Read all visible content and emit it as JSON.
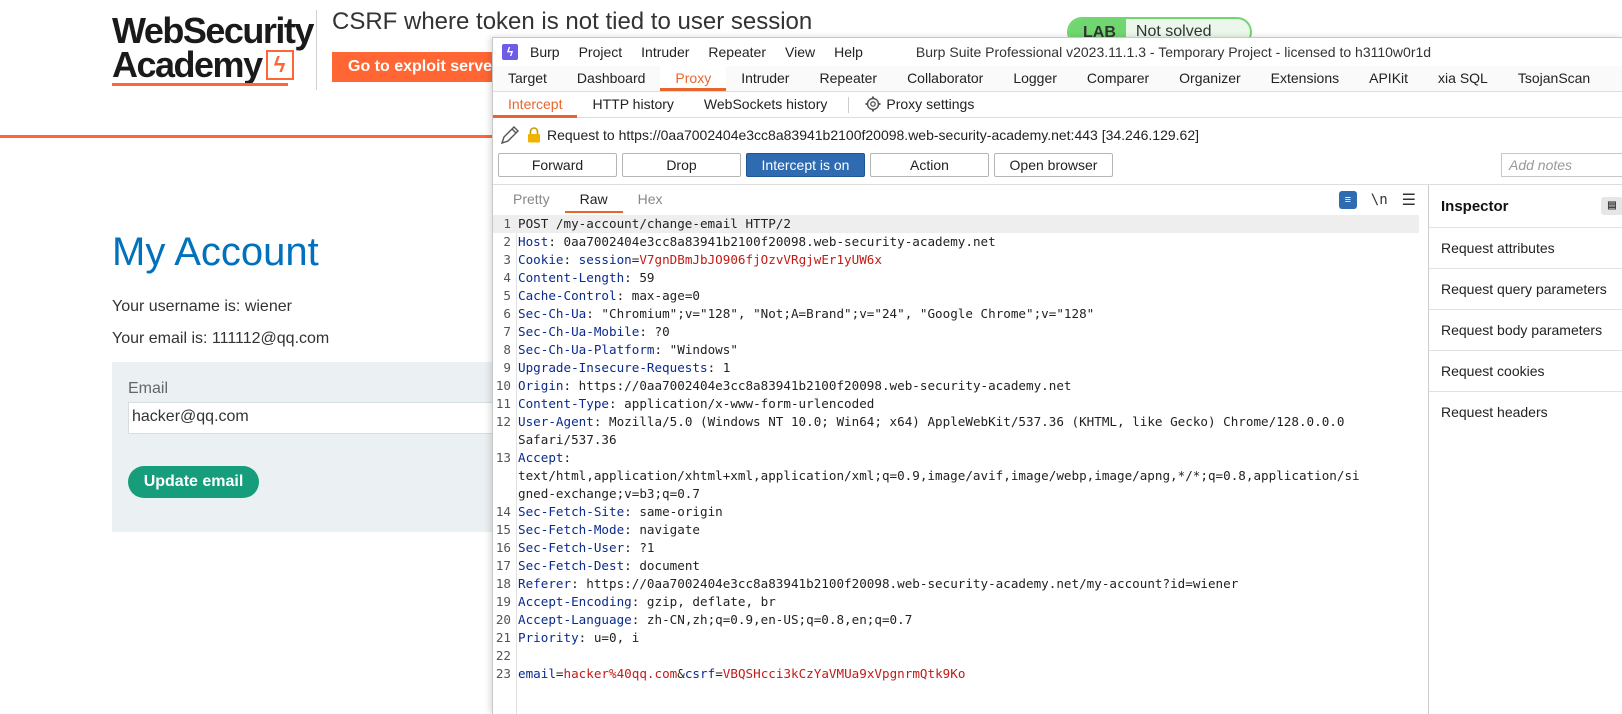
{
  "site": {
    "logo_line1": "WebSecurity",
    "logo_line2": "Academy",
    "lab_title": "CSRF where token is not tied to user session",
    "exploit_button": "Go to exploit server",
    "lab_badge": "LAB",
    "lab_status": "Not solved",
    "page_heading": "My Account",
    "username_line": "Your username is: wiener",
    "email_line": "Your email is: 111112@qq.com",
    "email_label": "Email",
    "email_value": "hacker@qq.com",
    "update_button": "Update email"
  },
  "burp": {
    "menu": [
      "Burp",
      "Project",
      "Intruder",
      "Repeater",
      "View",
      "Help"
    ],
    "window_title": "Burp Suite Professional v2023.11.1.3 - Temporary Project - licensed to h3110w0r1d",
    "main_tabs": [
      "Target",
      "Dashboard",
      "Proxy",
      "Intruder",
      "Repeater",
      "Collaborator",
      "Logger",
      "Comparer",
      "Organizer",
      "Extensions",
      "APIKit",
      "xia SQL",
      "TsojanScan"
    ],
    "active_main_tab": "Proxy",
    "sub_tabs": [
      "Intercept",
      "HTTP history",
      "WebSockets history"
    ],
    "active_sub_tab": "Intercept",
    "proxy_settings": "Proxy settings",
    "request_to": "Request to https://0aa7002404e3cc8a83941b2100f20098.web-security-academy.net:443  [34.246.129.62]",
    "buttons": {
      "forward": "Forward",
      "drop": "Drop",
      "intercept": "Intercept is on",
      "action": "Action",
      "open_browser": "Open browser"
    },
    "notes_placeholder": "Add notes",
    "view_tabs": [
      "Pretty",
      "Raw",
      "Hex"
    ],
    "active_view_tab": "Raw",
    "newline_toggle": "\\n",
    "request_lines": [
      {
        "n": "1",
        "k": "",
        "sep": "",
        "v": "POST /my-account/change-email HTTP/2"
      },
      {
        "n": "2",
        "k": "Host",
        "sep": ": ",
        "v": "0aa7002404e3cc8a83941b2100f20098.web-security-academy.net"
      },
      {
        "n": "3",
        "k": "Cookie",
        "sep": ": ",
        "v": ""
      },
      {
        "n": "4",
        "k": "Content-Length",
        "sep": ": ",
        "v": "59"
      },
      {
        "n": "5",
        "k": "Cache-Control",
        "sep": ": ",
        "v": "max-age=0"
      },
      {
        "n": "6",
        "k": "Sec-Ch-Ua",
        "sep": ": ",
        "v": "\"Chromium\";v=\"128\", \"Not;A=Brand\";v=\"24\", \"Google Chrome\";v=\"128\""
      },
      {
        "n": "7",
        "k": "Sec-Ch-Ua-Mobile",
        "sep": ": ",
        "v": "?0"
      },
      {
        "n": "8",
        "k": "Sec-Ch-Ua-Platform",
        "sep": ": ",
        "v": "\"Windows\""
      },
      {
        "n": "9",
        "k": "Upgrade-Insecure-Requests",
        "sep": ": ",
        "v": "1"
      },
      {
        "n": "10",
        "k": "Origin",
        "sep": ": ",
        "v": "https://0aa7002404e3cc8a83941b2100f20098.web-security-academy.net"
      },
      {
        "n": "11",
        "k": "Content-Type",
        "sep": ": ",
        "v": "application/x-www-form-urlencoded"
      },
      {
        "n": "12",
        "k": "User-Agent",
        "sep": ": ",
        "v": "Mozilla/5.0 (Windows NT 10.0; Win64; x64) AppleWebKit/537.36 (KHTML, like Gecko) Chrome/128.0.0.0",
        "cont": "Safari/537.36"
      },
      {
        "n": "13",
        "k": "Accept",
        "sep": ":",
        "v": "",
        "cont": "text/html,application/xhtml+xml,application/xml;q=0.9,image/avif,image/webp,image/apng,*/*;q=0.8,application/si",
        "cont2": "gned-exchange;v=b3;q=0.7"
      },
      {
        "n": "14",
        "k": "Sec-Fetch-Site",
        "sep": ": ",
        "v": "same-origin"
      },
      {
        "n": "15",
        "k": "Sec-Fetch-Mode",
        "sep": ": ",
        "v": "navigate"
      },
      {
        "n": "16",
        "k": "Sec-Fetch-User",
        "sep": ": ",
        "v": "?1"
      },
      {
        "n": "17",
        "k": "Sec-Fetch-Dest",
        "sep": ": ",
        "v": "document"
      },
      {
        "n": "18",
        "k": "Referer",
        "sep": ": ",
        "v": "https://0aa7002404e3cc8a83941b2100f20098.web-security-academy.net/my-account?id=wiener"
      },
      {
        "n": "19",
        "k": "Accept-Encoding",
        "sep": ": ",
        "v": "gzip, deflate, br"
      },
      {
        "n": "20",
        "k": "Accept-Language",
        "sep": ": ",
        "v": "zh-CN,zh;q=0.9,en-US;q=0.8,en;q=0.7"
      },
      {
        "n": "21",
        "k": "Priority",
        "sep": ": ",
        "v": "u=0, i"
      },
      {
        "n": "22",
        "k": "",
        "sep": "",
        "v": ""
      },
      {
        "n": "23",
        "k": "",
        "sep": "",
        "v": ""
      }
    ],
    "cookie_name": "session",
    "cookie_value": "V7gnDBmJbJO906fjOzvVRgjwEr1yUW6x",
    "body_params": [
      {
        "name": "email",
        "value": "hacker%40qq.com"
      },
      {
        "name": "csrf",
        "value": "VBQSHcci3kCzYaVMUa9xVpgnrmQtk9Ko"
      }
    ],
    "inspector_title": "Inspector",
    "inspector_items": [
      "Request attributes",
      "Request query parameters",
      "Request body parameters",
      "Request cookies",
      "Request headers"
    ]
  },
  "colors": {
    "academy_orange": "#ff6633",
    "academy_blue": "#0071bc",
    "academy_green": "#169e7c",
    "burp_accent": "#e8662e",
    "intercept_on": "#2e6bb0",
    "header_key": "#0a2a8e",
    "param_value": "#c41a16"
  }
}
